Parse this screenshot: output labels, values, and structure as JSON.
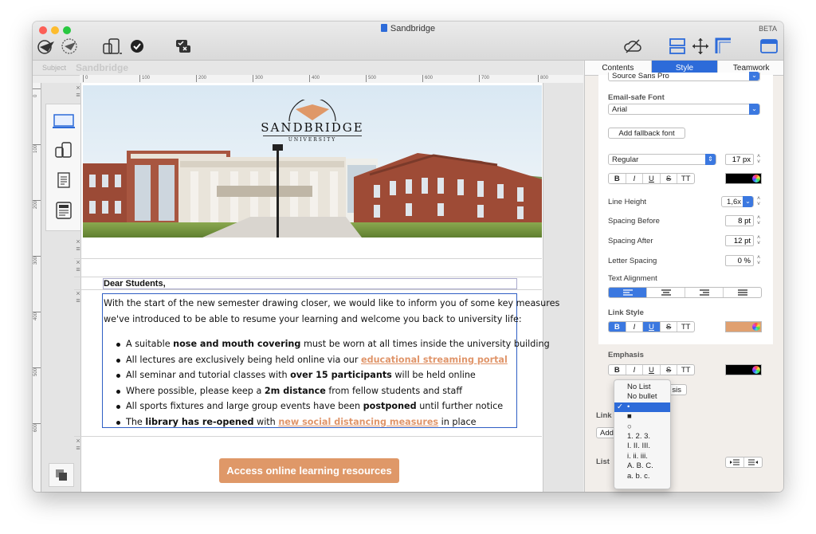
{
  "window": {
    "title": "Sandbridge",
    "badge": "BETA"
  },
  "subject": {
    "label": "Subject",
    "value": "Sandbridge"
  },
  "ruler": {
    "h": [
      "0",
      "100",
      "200",
      "300",
      "400",
      "500",
      "600",
      "700",
      "800"
    ],
    "v": [
      "0",
      "100",
      "200",
      "300",
      "400",
      "500",
      "600"
    ]
  },
  "email": {
    "logo_name": "SANDBRIDGE",
    "logo_sub": "UNIVERSITY",
    "greeting": "Dear Students,",
    "intro_1": "With the start of the new semester drawing closer, we would like to inform you of some key measures",
    "intro_2": "we've introduced to be able to resume your learning and welcome you back to university life:",
    "bullets": [
      {
        "pre": "A suitable ",
        "bold": "nose and mouth covering",
        "post": " must be worn at all times inside the university building"
      },
      {
        "pre": "All lectures are exclusively being held online via our ",
        "link": "educational streaming portal",
        "post": ""
      },
      {
        "pre": "All seminar and tutorial classes with ",
        "bold": "over 15 participants",
        "post": " will be held online"
      },
      {
        "pre": "Where possible, please keep a ",
        "bold": "2m distance",
        "post": " from fellow students and staff"
      },
      {
        "pre": "All sports fixtures and large group events have been ",
        "bold": "postponed",
        "post": " until further notice"
      },
      {
        "pre": "The ",
        "bold": "library has re-opened",
        "mid": " with ",
        "link": "new social distancing measures",
        "post": " in place"
      }
    ],
    "cta": "Access online learning resources",
    "link_color": "#e0956a",
    "cta_color": "#df9868"
  },
  "panel": {
    "tabs": [
      "Contents",
      "Style",
      "Teamwork"
    ],
    "selected_tab": "Style",
    "font_top": "Source Sans Pro",
    "email_safe_label": "Email-safe Font",
    "email_safe_value": "Arial",
    "add_fallback": "Add fallback font",
    "weight": "Regular",
    "size": "17 px",
    "fmt": [
      "B",
      "I",
      "U",
      "S",
      "TT"
    ],
    "text_color": "#000000",
    "line_height_label": "Line Height",
    "line_height": "1,6x",
    "spacing_before_label": "Spacing Before",
    "spacing_before": "8 pt",
    "spacing_after_label": "Spacing After",
    "spacing_after": "12 pt",
    "letter_spacing_label": "Letter Spacing",
    "letter_spacing": "0 %",
    "text_alignment_label": "Text Alignment",
    "link_style_label": "Link Style",
    "link_color": "#e0a070",
    "emphasis_label": "Emphasis",
    "emphasis_color": "#000000",
    "emphasis_btn_tail": "sis",
    "link_section": "Link",
    "link_add": "Add",
    "list_section": "List"
  },
  "list_menu": {
    "items": [
      "No List",
      "No bullet",
      "•",
      "■",
      "○",
      "1. 2. 3.",
      "I. II. III.",
      "i. ii. iii.",
      "A. B. C.",
      "a. b. c."
    ],
    "selected": "•"
  },
  "accent": "#2d6bd9"
}
